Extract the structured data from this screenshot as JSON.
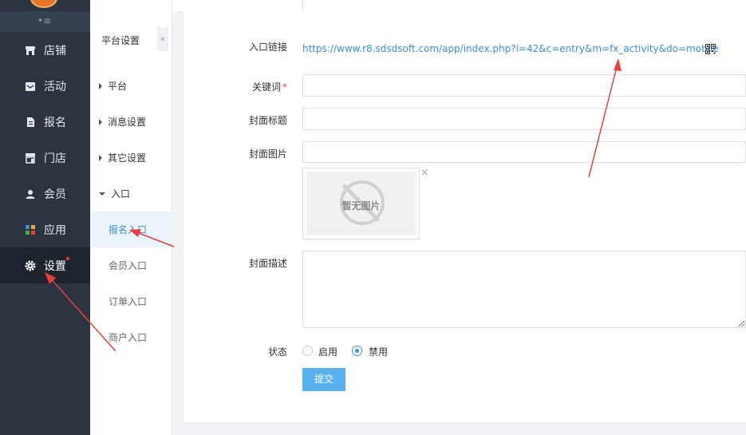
{
  "sidebar": {
    "collapse_glyph": "•≡",
    "items": [
      {
        "label": "店铺",
        "icon": "store-icon"
      },
      {
        "label": "活动",
        "icon": "activity-icon"
      },
      {
        "label": "报名",
        "icon": "signup-icon"
      },
      {
        "label": "门店",
        "icon": "shop-icon"
      },
      {
        "label": "会员",
        "icon": "member-icon"
      },
      {
        "label": "应用",
        "icon": "apps-icon"
      },
      {
        "label": "设置",
        "icon": "gear-icon",
        "active": true
      }
    ]
  },
  "subnav": {
    "title": "平台设置",
    "collapse_glyph": "«",
    "groups": [
      {
        "label": "平台",
        "expanded": false
      },
      {
        "label": "消息设置",
        "expanded": false
      },
      {
        "label": "其它设置",
        "expanded": false
      },
      {
        "label": "入口",
        "expanded": true
      }
    ],
    "leaves": [
      {
        "label": "报名入口",
        "active": true
      },
      {
        "label": "会员入口"
      },
      {
        "label": "订单入口"
      },
      {
        "label": "商户入口"
      }
    ]
  },
  "form": {
    "entry_link_label": "入口链接",
    "entry_link_url": "https://www.r8.sdsdsoft.com/app/index.php?i=42&c=entry&m=fx_activity&do=mobile",
    "keyword_label": "关键词",
    "required_mark": "*",
    "keyword_value": "",
    "cover_title_label": "封面标题",
    "cover_title_value": "",
    "cover_image_label": "封面图片",
    "cover_image_value": "",
    "no_image_text": "暂无图片",
    "remove_glyph": "×",
    "cover_desc_label": "封面描述",
    "status_label": "状态",
    "status_options": [
      {
        "label": "启用",
        "checked": false
      },
      {
        "label": "禁用",
        "checked": true
      }
    ],
    "submit_label": "提交"
  },
  "colors": {
    "sidebar_bg": "#2b3440",
    "accent": "#3a8ee6",
    "submit_bg": "#5ab1ef",
    "annotation_red": "#e8403a"
  }
}
